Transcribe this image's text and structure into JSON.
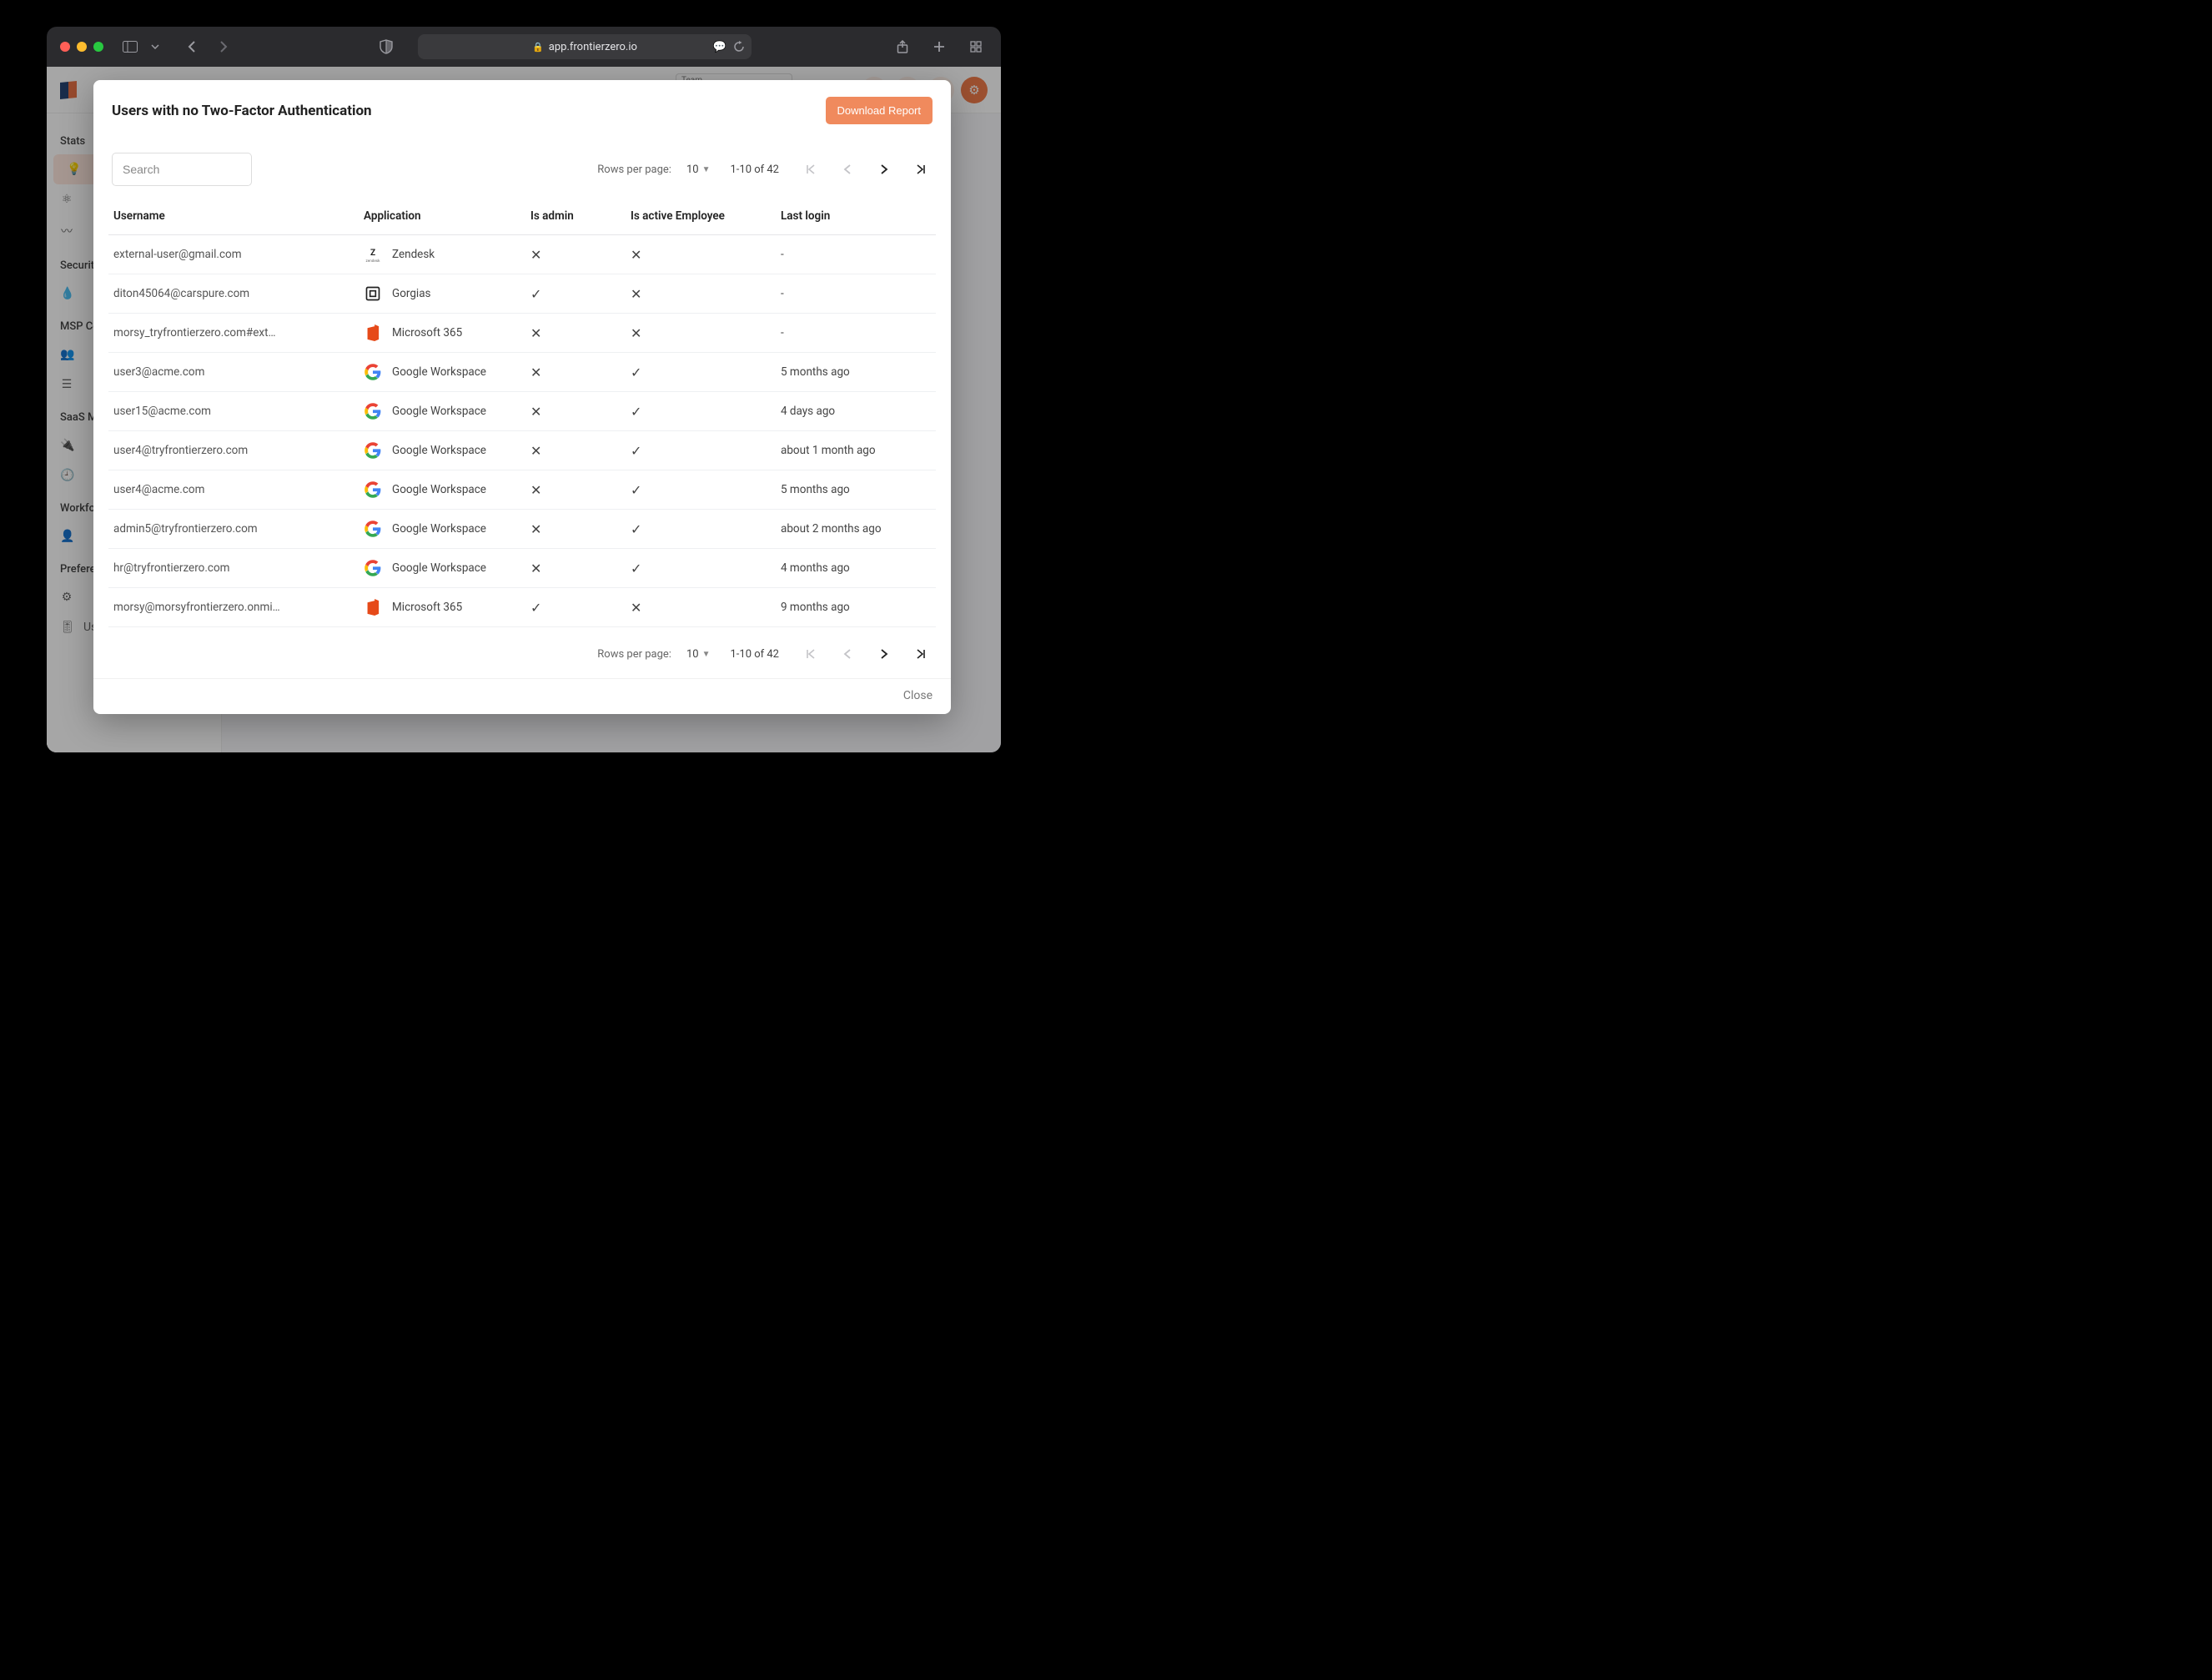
{
  "browser": {
    "url_host": "app.frontierzero.io"
  },
  "app": {
    "team_label": "Team"
  },
  "sidebar": {
    "sections": [
      {
        "title": "Stats",
        "items": [
          {
            "icon": "lightbulb-icon",
            "label": "",
            "active": true
          },
          {
            "icon": "nodes-icon",
            "label": ""
          },
          {
            "icon": "activity-icon",
            "label": ""
          }
        ]
      },
      {
        "title": "Security",
        "items": [
          {
            "icon": "drop-icon",
            "label": ""
          }
        ]
      },
      {
        "title": "MSP Co",
        "items": [
          {
            "icon": "person-group-icon",
            "label": ""
          },
          {
            "icon": "list-icon",
            "label": ""
          }
        ]
      },
      {
        "title": "SaaS Ma",
        "items": [
          {
            "icon": "plug-icon",
            "label": ""
          },
          {
            "icon": "clock-icon",
            "label": ""
          }
        ]
      },
      {
        "title": "Workfor",
        "items": [
          {
            "icon": "person-icon",
            "label": ""
          }
        ]
      },
      {
        "title": "Preferen",
        "items": [
          {
            "icon": "gear-icon",
            "label": ""
          },
          {
            "icon": "sliders-icon",
            "label": "User Settings"
          }
        ]
      }
    ]
  },
  "modal": {
    "title": "Users with no Two-Factor Authentication",
    "download_label": "Download Report",
    "search_placeholder": "Search",
    "close_label": "Close",
    "rows_per_page_label": "Rows per page:",
    "rows_per_page_value": "10",
    "range_text": "1-10 of 42",
    "columns": {
      "username": "Username",
      "application": "Application",
      "is_admin": "Is admin",
      "is_active": "Is active Employee",
      "last_login": "Last login"
    },
    "rows": [
      {
        "username": "external-user@gmail.com",
        "app": "Zendesk",
        "app_icon": "zendesk",
        "is_admin": false,
        "is_active": false,
        "last_login": "-"
      },
      {
        "username": "diton45064@carspure.com",
        "app": "Gorgias",
        "app_icon": "gorgias",
        "is_admin": true,
        "is_active": false,
        "last_login": "-"
      },
      {
        "username": "morsy_tryfrontierzero.com#ext#@mor…",
        "app": "Microsoft 365",
        "app_icon": "m365",
        "is_admin": false,
        "is_active": false,
        "last_login": "-"
      },
      {
        "username": "user3@acme.com",
        "app": "Google Workspace",
        "app_icon": "google",
        "is_admin": false,
        "is_active": true,
        "last_login": "5 months ago"
      },
      {
        "username": "user15@acme.com",
        "app": "Google Workspace",
        "app_icon": "google",
        "is_admin": false,
        "is_active": true,
        "last_login": "4 days ago"
      },
      {
        "username": "user4@tryfrontierzero.com",
        "app": "Google Workspace",
        "app_icon": "google",
        "is_admin": false,
        "is_active": true,
        "last_login": "about 1 month ago"
      },
      {
        "username": "user4@acme.com",
        "app": "Google Workspace",
        "app_icon": "google",
        "is_admin": false,
        "is_active": true,
        "last_login": "5 months ago"
      },
      {
        "username": "admin5@tryfrontierzero.com",
        "app": "Google Workspace",
        "app_icon": "google",
        "is_admin": false,
        "is_active": true,
        "last_login": "about 2 months ago"
      },
      {
        "username": "hr@tryfrontierzero.com",
        "app": "Google Workspace",
        "app_icon": "google",
        "is_admin": false,
        "is_active": true,
        "last_login": "4 months ago"
      },
      {
        "username": "morsy@morsyfrontierzero.onmicrosoft…",
        "app": "Microsoft 365",
        "app_icon": "m365",
        "is_admin": true,
        "is_active": false,
        "last_login": "9 months ago"
      }
    ]
  }
}
